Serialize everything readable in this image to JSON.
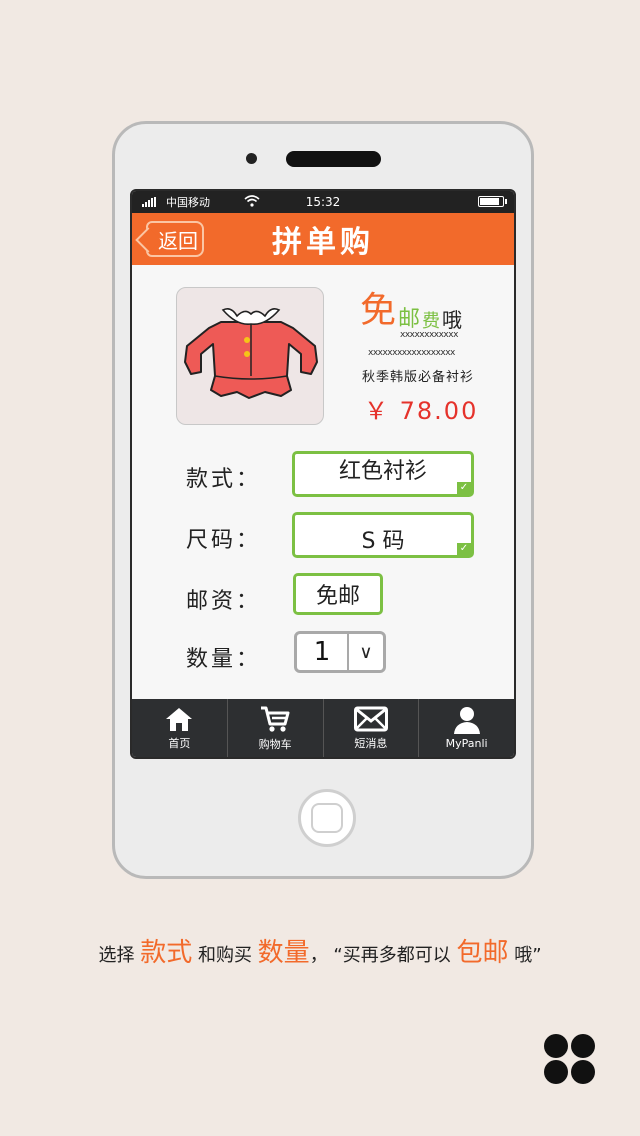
{
  "statusbar": {
    "carrier": "中国移动",
    "time": "15:32"
  },
  "header": {
    "back_label": "返回",
    "title": "拼单购"
  },
  "product": {
    "promo": {
      "c1": "免",
      "c2": "邮",
      "c3": "费",
      "c4": "哦"
    },
    "line1": "xxxxxxxxxxxx",
    "line2": "xxxxxxxxxxxxxxxxxx",
    "description": "秋季韩版必备衬衫",
    "price": "￥ 78.00"
  },
  "form": {
    "style_label": "款式：",
    "style_value": "红色衬衫",
    "size_label": "尺码：",
    "size_value": "S 码",
    "shipping_label": "邮资：",
    "shipping_value": "免邮",
    "quantity_label": "数量：",
    "quantity_value": "1",
    "quantity_dropdown": "∨"
  },
  "tabs": [
    {
      "label": "首页",
      "icon": "home-icon"
    },
    {
      "label": "购物车",
      "icon": "cart-icon"
    },
    {
      "label": "短消息",
      "icon": "mail-icon"
    },
    {
      "label": "MyPanli",
      "icon": "user-icon"
    }
  ],
  "caption": {
    "t1": "选择 ",
    "h1": "款式",
    "t2": " 和购买 ",
    "h2": "数量",
    "t3": "，  “买再多都可以 ",
    "h3": "包邮",
    "t4": " 哦”"
  },
  "colors": {
    "accent": "#f26a2b",
    "green": "#7cc043",
    "price": "#e5322b"
  }
}
